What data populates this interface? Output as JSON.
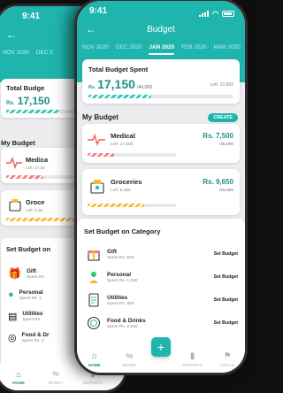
{
  "status": {
    "time": "9:41"
  },
  "header": {
    "title": "Budget",
    "back_icon": "arrow-left-icon"
  },
  "months": [
    "NOV 2020",
    "DEC 2020",
    "JAN 2020",
    "FEB 2020",
    "MAR 2020"
  ],
  "active_month": "JAN 2020",
  "total_budget": {
    "title": "Total Budget Spent",
    "currency": "Rs.",
    "spent": "17,150",
    "limit": "/40,000",
    "left": "Left: 22,850",
    "progress": 0.43
  },
  "my_budget": {
    "title": "My Budget",
    "create_label": "CREATE",
    "items": [
      {
        "name": "Medical",
        "left": "Left: 17,500",
        "amount": "Rs. 7,500",
        "limit": "/25,000",
        "progress": 0.3,
        "color": "#f07c7c",
        "icon": "heartbeat-icon"
      },
      {
        "name": "Groceries",
        "left": "Left: 5,350",
        "amount": "Rs. 9,650",
        "limit": "/15,000",
        "progress": 0.64,
        "color": "#f7b733",
        "icon": "grocery-bag-icon"
      }
    ]
  },
  "categories": {
    "title": "Set Budget on Category",
    "set_label": "Set Budget",
    "items": [
      {
        "name": "Gift",
        "spent": "Spent Rs. 500",
        "icon": "gift-icon"
      },
      {
        "name": "Personal",
        "spent": "Spent Rs. 1,300",
        "icon": "person-icon"
      },
      {
        "name": "Utilities",
        "spent": "Spent Rs. 800",
        "icon": "utilities-icon"
      },
      {
        "name": "Food & Drinks",
        "spent": "Spent Rs. 2,550",
        "icon": "food-drinks-icon"
      }
    ]
  },
  "tabbar": {
    "items": [
      "HOME",
      "MONEY",
      "REPORTS",
      "GOALS"
    ],
    "active": "HOME",
    "fab": "+"
  },
  "back_phone": {
    "months": [
      "NOV 2020",
      "DEC 2"
    ],
    "total_title": "Total Budge",
    "total_amount": "17,150",
    "my_budget": "My Budget",
    "items": [
      {
        "name": "Medica",
        "left": "Left: 17,50"
      },
      {
        "name": "Groce",
        "left": "Left: 5,35"
      }
    ],
    "section": "Set Budget on",
    "cats": [
      {
        "name": "Gift",
        "sub": "Spent Rs."
      },
      {
        "name": "Personal",
        "sub": "Spent Rs. 1,"
      },
      {
        "name": "Utilities",
        "sub": "Spent Rs."
      },
      {
        "name": "Food & Dr",
        "sub": "Spent Rs. 2"
      }
    ],
    "tabs": [
      "HOME",
      "MONEY",
      "REPORTS",
      "GOALS"
    ]
  }
}
